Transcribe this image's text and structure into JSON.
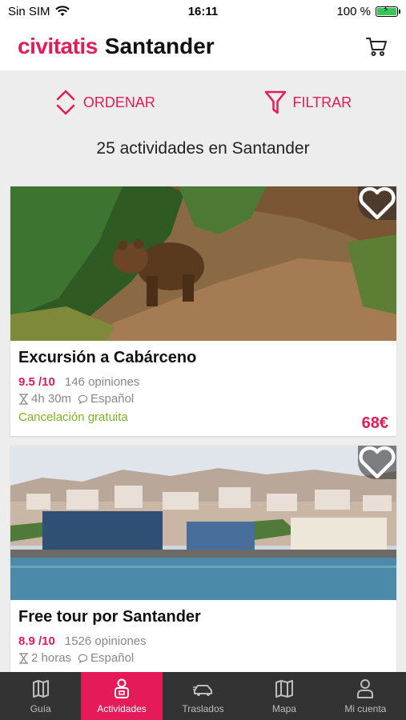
{
  "status_bar": {
    "carrier": "Sin SIM",
    "time": "16:11",
    "battery": "100 %"
  },
  "header": {
    "brand": "civitatis",
    "city": "Santander"
  },
  "toolbar": {
    "sort_label": "ORDENAR",
    "filter_label": "FILTRAR"
  },
  "results": {
    "count_text": "25 actividades en Santander"
  },
  "activities": [
    {
      "title": "Excursión a Cabárceno",
      "rating": "9.5 /10",
      "opinions": "146 opiniones",
      "duration": "4h 30m",
      "language": "Español",
      "cancellation": "Cancelación gratuita",
      "price": "68€"
    },
    {
      "title": "Free tour por Santander",
      "rating": "8.9 /10",
      "opinions": "1526 opiniones",
      "duration": "2 horas",
      "language": "Español"
    }
  ],
  "bottom_nav": {
    "items": [
      {
        "label": "Guía",
        "icon": "map-book-icon"
      },
      {
        "label": "Actividades",
        "icon": "person-ticket-icon"
      },
      {
        "label": "Traslados",
        "icon": "car-icon"
      },
      {
        "label": "Mapa",
        "icon": "map-icon"
      },
      {
        "label": "Mi cuenta",
        "icon": "user-icon"
      }
    ],
    "active_index": 1
  },
  "colors": {
    "brand": "#e41b58",
    "success": "#7bb51b",
    "nav_background": "#333333"
  }
}
